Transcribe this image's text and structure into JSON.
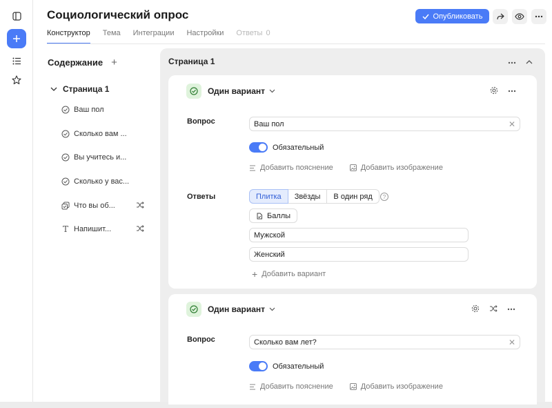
{
  "header": {
    "title": "Социологический опрос",
    "tabs": [
      {
        "label": "Конструктор"
      },
      {
        "label": "Тема"
      },
      {
        "label": "Интеграции"
      },
      {
        "label": "Настройки"
      },
      {
        "label": "Ответы",
        "count": "0"
      }
    ],
    "publish_label": "Опубликовать"
  },
  "sidebar": {
    "contents_title": "Содержание",
    "page_label": "Страница 1",
    "items": [
      {
        "label": "Ваш пол",
        "icon": "radio-check-icon"
      },
      {
        "label": "Сколько вам ...",
        "icon": "radio-check-icon"
      },
      {
        "label": "Вы учитесь и...",
        "icon": "radio-check-icon"
      },
      {
        "label": "Сколько у вас...",
        "icon": "radio-check-icon"
      },
      {
        "label": "Что вы об...",
        "icon": "multi-choice-icon"
      },
      {
        "label": "Напишит...",
        "icon": "text-icon"
      }
    ]
  },
  "main": {
    "page_title": "Страница 1",
    "cards": [
      {
        "type_label": "Один вариант",
        "question_label": "Вопрос",
        "question_value": "Ваш пол",
        "required_label": "Обязательный",
        "add_explanation": "Добавить пояснение",
        "add_image": "Добавить изображение",
        "answers_label": "Ответы",
        "views": [
          "Плитка",
          "Звёзды",
          "В один ряд"
        ],
        "balls_label": "Баллы",
        "options": [
          "Мужской",
          "Женский"
        ],
        "add_variant": "Добавить вариант"
      },
      {
        "type_label": "Один вариант",
        "question_label": "Вопрос",
        "question_value": "Сколько вам лет?",
        "required_label": "Обязательный",
        "add_explanation": "Добавить пояснение",
        "add_image": "Добавить изображение"
      }
    ]
  },
  "colors": {
    "accent": "#4a7bf7",
    "badge_bg": "#dff3dc",
    "badge_icon": "#2e7d32"
  }
}
